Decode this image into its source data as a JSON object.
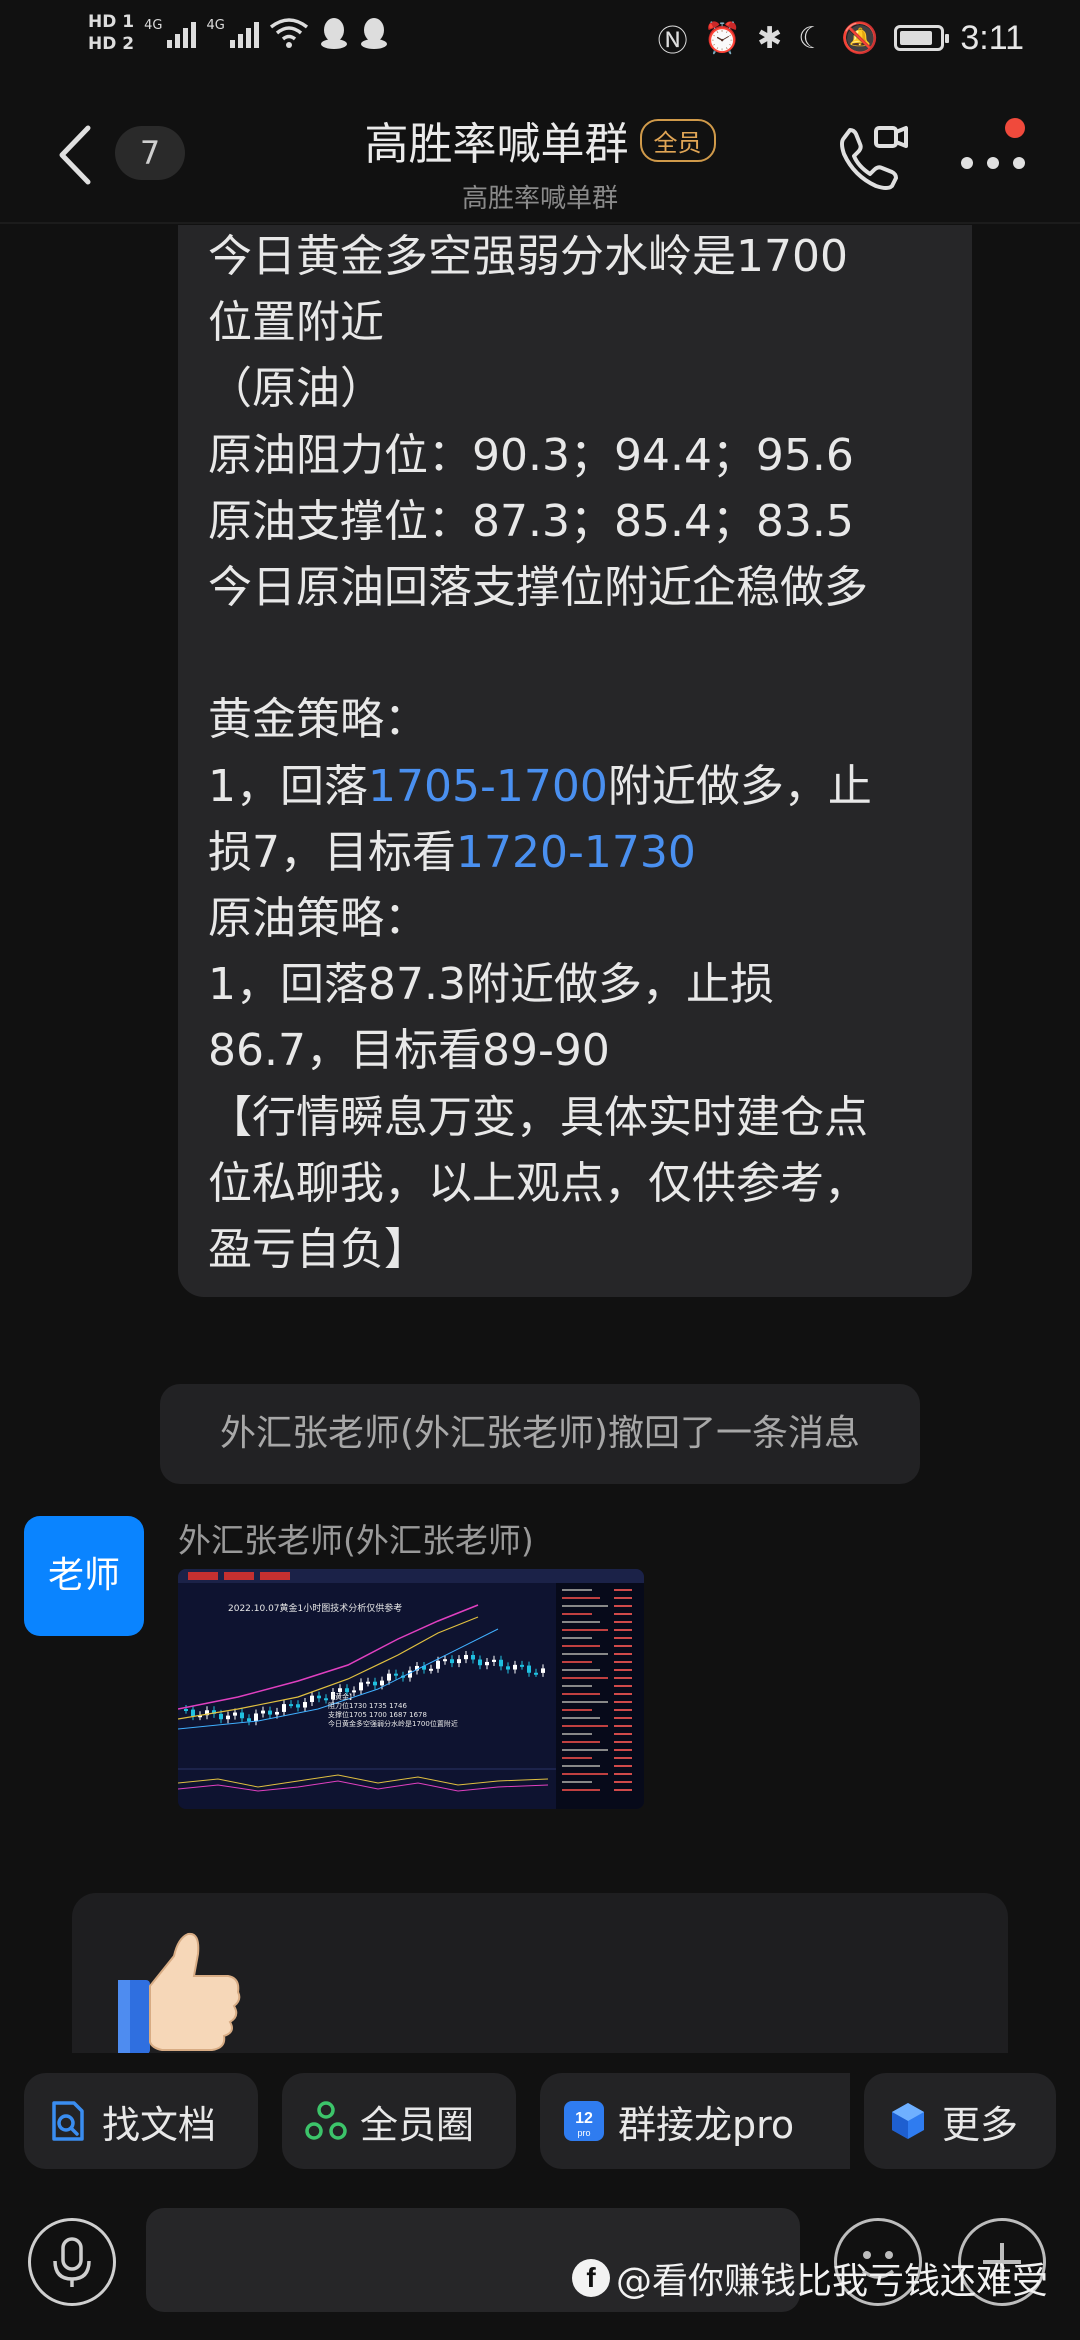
{
  "status_bar": {
    "hd1": "HD 1",
    "hd2": "HD 2",
    "net1": "4G",
    "net2": "4G",
    "time": "3:11",
    "battery_level": 0.85
  },
  "header": {
    "back_count": "7",
    "title": "高胜率喊单群",
    "member_tag": "全员",
    "subtitle": "高胜率喊单群"
  },
  "message": {
    "lines": [
      {
        "a": "今日黄金多空强弱分水岭是1700",
        "b": "",
        "c": ""
      },
      {
        "a": "位置附近",
        "b": "",
        "c": ""
      },
      {
        "a": "（原油）",
        "b": "",
        "c": ""
      },
      {
        "a": "原油阻力位：90.3；94.4；95.6",
        "b": "",
        "c": ""
      },
      {
        "a": "原油支撑位：87.3；85.4；83.5",
        "b": "",
        "c": ""
      },
      {
        "a": "今日原油回落支撑位附近企稳做多",
        "b": "",
        "c": ""
      },
      {
        "a": "",
        "b": "",
        "c": ""
      },
      {
        "a": "黄金策略：",
        "b": "",
        "c": ""
      },
      {
        "a": "1，回落",
        "b": "1705-1700",
        "c": "附近做多，止"
      },
      {
        "a": "损7，目标看",
        "b": "1720-1730",
        "c": ""
      },
      {
        "a": "原油策略：",
        "b": "",
        "c": ""
      },
      {
        "a": "1，回落87.3附近做多，止损",
        "b": "",
        "c": ""
      },
      {
        "a": "86.7，目标看89-90",
        "b": "",
        "c": ""
      },
      {
        "a": "【行情瞬息万变，具体实时建仓点",
        "b": "",
        "c": ""
      },
      {
        "a": "位私聊我，以上观点，仅供参考，",
        "b": "",
        "c": ""
      },
      {
        "a": "盈亏自负】",
        "b": "",
        "c": ""
      }
    ]
  },
  "recall_notice": "外汇张老师(外汇张老师)撤回了一条消息",
  "sender": {
    "avatar_text": "老师",
    "name": "外汇张老师(外汇张老师)"
  },
  "chart_image": {
    "title": "2022.10.07黄金1小时图技术分析仅供参考",
    "note_head": "【黄金】",
    "note_1": "阻力位1730  1735  1746",
    "note_2": "支撑位1705  1700  1687  1678",
    "note_3": "今日黄金多空强弱分水岭是1700位置附近"
  },
  "toolbar": {
    "items": [
      {
        "label": "找文档",
        "icon": "find-doc-icon"
      },
      {
        "label": "全员圈",
        "icon": "circle-icon"
      },
      {
        "label": "群接龙pro",
        "icon": "relay-pro-icon"
      },
      {
        "label": "更多",
        "icon": "more-apps-icon"
      }
    ]
  },
  "watermark": "@看你赚钱比我亏钱还难受",
  "colors": {
    "accent_blue": "#4a90f0",
    "avatar_blue": "#0a84ff",
    "member_tag": "#e0a555",
    "notification_dot": "#f04a3c"
  }
}
